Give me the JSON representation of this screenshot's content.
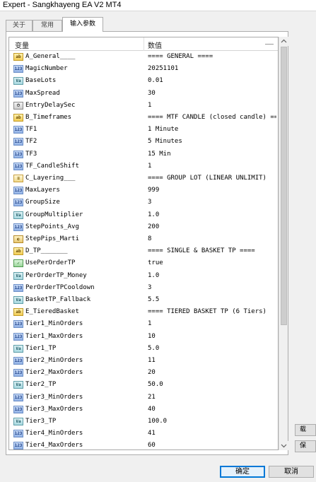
{
  "window": {
    "title": "Expert - Sangkhayeng EA V2 MT4"
  },
  "tabs": [
    {
      "label": "关于",
      "active": false
    },
    {
      "label": "常用",
      "active": false
    },
    {
      "label": "输入参数",
      "active": true
    }
  ],
  "grid": {
    "headers": {
      "variable": "变量",
      "value": "数值"
    },
    "rows": [
      {
        "type": "ab",
        "var": "A_General____",
        "val": "==== GENERAL ===="
      },
      {
        "type": "123",
        "var": "MagicNumber",
        "val": "20251101"
      },
      {
        "type": "Va",
        "var": "BaseLots",
        "val": "0.01"
      },
      {
        "type": "123",
        "var": "MaxSpread",
        "val": "30"
      },
      {
        "type": "dt",
        "var": "EntryDelaySec",
        "val": "1"
      },
      {
        "type": "ab",
        "var": "B_Timeframes",
        "val": "==== MTF CANDLE (closed candle) =="
      },
      {
        "type": "123",
        "var": "TF1",
        "val": "1 Minute"
      },
      {
        "type": "123",
        "var": "TF2",
        "val": "5 Minutes"
      },
      {
        "type": "123",
        "var": "TF3",
        "val": "15 Min"
      },
      {
        "type": "123",
        "var": "TF_CandleShift",
        "val": "1"
      },
      {
        "type": "sep",
        "var": "C_Layering___",
        "val": "==== GROUP LOT (LINEAR UNLIMIT)"
      },
      {
        "type": "123",
        "var": "MaxLayers",
        "val": "999"
      },
      {
        "type": "123",
        "var": "GroupSize",
        "val": "3"
      },
      {
        "type": "Va",
        "var": "GroupMultiplier",
        "val": "1.0"
      },
      {
        "type": "123",
        "var": "StepPoints_Avg",
        "val": "200"
      },
      {
        "type": "col",
        "var": "StepPips_Marti",
        "val": "8"
      },
      {
        "type": "ab",
        "var": "D_TP_______",
        "val": "==== SINGLE & BASKET TP ===="
      },
      {
        "type": "bool",
        "var": "UsePerOrderTP",
        "val": "true"
      },
      {
        "type": "Va",
        "var": "PerOrderTP_Money",
        "val": "1.0"
      },
      {
        "type": "123",
        "var": "PerOrderTPCooldown",
        "val": "3"
      },
      {
        "type": "Va",
        "var": "BasketTP_Fallback",
        "val": "5.5"
      },
      {
        "type": "ab",
        "var": "E_TieredBasket",
        "val": "==== TIERED BASKET TP (6 Tiers)"
      },
      {
        "type": "123",
        "var": "Tier1_MinOrders",
        "val": "1"
      },
      {
        "type": "123",
        "var": "Tier1_MaxOrders",
        "val": "10"
      },
      {
        "type": "Va",
        "var": "Tier1_TP",
        "val": "5.0"
      },
      {
        "type": "123",
        "var": "Tier2_MinOrders",
        "val": "11"
      },
      {
        "type": "123",
        "var": "Tier2_MaxOrders",
        "val": "20"
      },
      {
        "type": "Va",
        "var": "Tier2_TP",
        "val": "50.0"
      },
      {
        "type": "123",
        "var": "Tier3_MinOrders",
        "val": "21"
      },
      {
        "type": "123",
        "var": "Tier3_MaxOrders",
        "val": "40"
      },
      {
        "type": "Va",
        "var": "Tier3_TP",
        "val": "100.0"
      },
      {
        "type": "123",
        "var": "Tier4_MinOrders",
        "val": "41"
      },
      {
        "type": "123",
        "var": "Tier4_MaxOrders",
        "val": "60"
      }
    ]
  },
  "side_buttons": [
    {
      "label": "载"
    },
    {
      "label": "保"
    }
  ],
  "buttons": {
    "ok": "确定",
    "cancel": "取消"
  },
  "icons": {
    "ab": "string-type-icon",
    "123": "integer-type-icon",
    "Va": "double-type-icon",
    "bool": "bool-type-icon",
    "dt": "datetime-type-icon",
    "col": "color-type-icon",
    "sep": "separator-type-icon"
  }
}
